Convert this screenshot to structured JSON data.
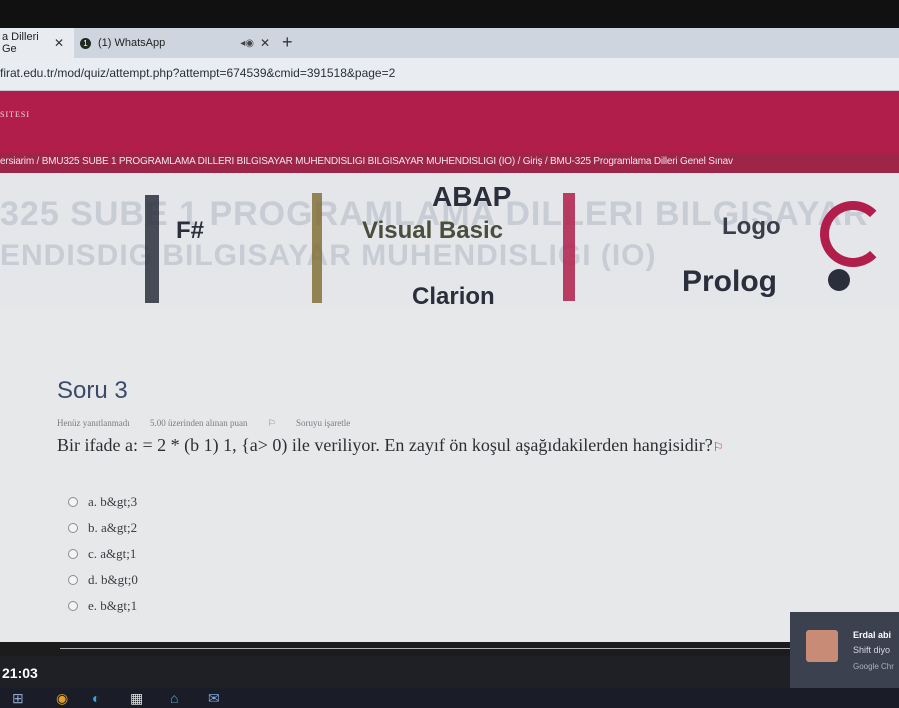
{
  "browser": {
    "tabs": [
      {
        "label": "a Dilleri Ge",
        "close": "✕"
      },
      {
        "label": "(1) WhatsApp",
        "badge": "1",
        "close": "✕"
      }
    ],
    "new_tab": "+",
    "url": "firat.edu.tr/mod/quiz/attempt.php?attempt=674539&cmid=391518&page=2"
  },
  "site": {
    "brand": "SITESI",
    "breadcrumb": "ersiarim / BMU325 SUBE 1 PROGRAMLAMA DILLERI BILGISAYAR MUHENDISLIGI BILGISAYAR MUHENDISLIGI (IO) / Giriş / BMU-325 Programlama Dilleri Genel Sınav"
  },
  "header_image": {
    "ghost_line1": "325 SUBE 1 PROGRAMLAMA DILLERI BILGISAYAR",
    "ghost_line2": "ENDISDIG BILGISAYAR MUHENDISLIGI (IO)",
    "logos": {
      "abap": "ABAP",
      "fsharp": "F#",
      "visual_basic": "Visual Basic",
      "logo": "Logo",
      "prolog": "Prolog",
      "clarion": "Clarion"
    },
    "colors": {
      "logo_dark": "#2b2f3c",
      "logo_red": "#b21e4b",
      "logo_olive": "#7d6a2f"
    }
  },
  "question": {
    "title": "Soru 3",
    "status": "Henüz yanıtlanmadı",
    "points": "5.00 üzerinden alınan puan",
    "flag": "Soruyu işaretle",
    "text": "Bir ifade a: = 2 * (b 1) 1, {a> 0) ile veriliyor. En zayıf ön koşul aşağıdakilerden hangisidir?",
    "options": [
      {
        "label": "a. b&gt;3"
      },
      {
        "label": "b. a&gt;2"
      },
      {
        "label": "c. a&gt;1"
      },
      {
        "label": "d. b&gt;0"
      },
      {
        "label": "e. b&gt;1"
      }
    ]
  },
  "notification": {
    "name": "Erdal abi",
    "message": "Shift diyo",
    "source": "Google Chr"
  },
  "taskbar": {
    "clock": "21:03",
    "icons": [
      "windows-icon",
      "chrome-icon",
      "edge-icon",
      "calendar-icon",
      "store-icon",
      "mail-icon"
    ]
  }
}
